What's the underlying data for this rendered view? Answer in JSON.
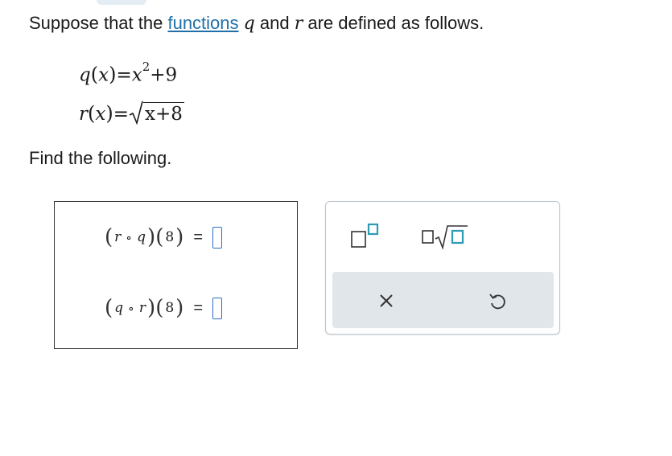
{
  "prompt": {
    "before": "Suppose that the ",
    "link": "functions",
    "middle1": " ",
    "var_q": "q",
    "middle2": " and ",
    "var_r": "r",
    "after": " are defined as follows."
  },
  "definitions": {
    "q": {
      "name": "q",
      "arg": "x",
      "base": "x",
      "exponent": "2",
      "rest": "+9"
    },
    "r": {
      "name": "r",
      "arg": "x",
      "radicand": "x+8"
    }
  },
  "find_label": "Find the following.",
  "questions": [
    {
      "outer": "r",
      "inner": "q",
      "compose": "∘",
      "value": "8",
      "equals": "="
    },
    {
      "outer": "q",
      "inner": "r",
      "compose": "∘",
      "value": "8",
      "equals": "="
    }
  ],
  "toolbox": {
    "buttons": [
      "superscript-tool",
      "sqrt-tool",
      "clear",
      "undo"
    ],
    "colors": {
      "accent": "#2b9cb4",
      "bar_bg": "#e1e6ea",
      "link": "#1f6fa8"
    }
  }
}
